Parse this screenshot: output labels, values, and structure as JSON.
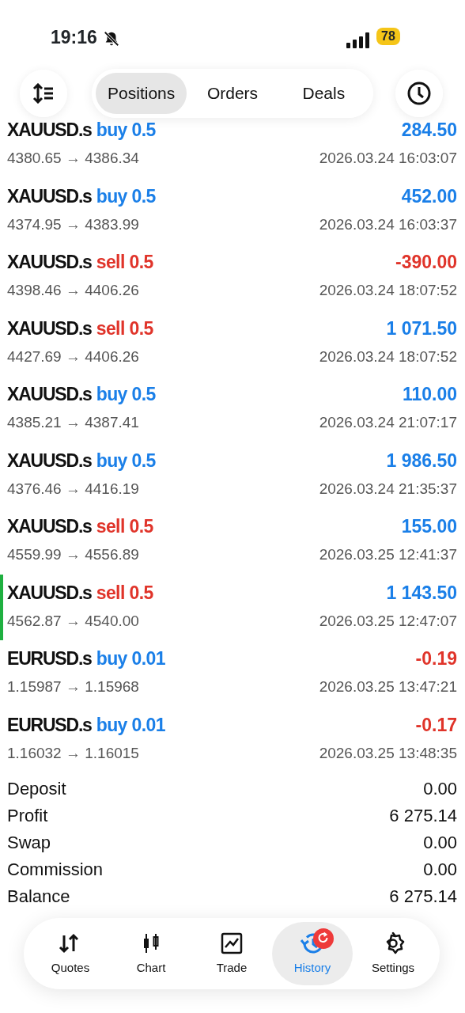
{
  "status_bar": {
    "time": "19:16",
    "battery": "78"
  },
  "toolbar": {
    "tabs": [
      {
        "label": "Positions",
        "selected": true
      },
      {
        "label": "Orders",
        "selected": false
      },
      {
        "label": "Deals",
        "selected": false
      }
    ]
  },
  "deals": [
    {
      "selected": false,
      "kind": "buy",
      "symbol": "XAUUSD.s",
      "side": "buy",
      "volume": "0.5",
      "profit": "284.50",
      "loss": false,
      "prices": "4380.65 → 4386.34",
      "time": "2026.03.24 16:03:07"
    },
    {
      "selected": false,
      "kind": "buy",
      "symbol": "XAUUSD.s",
      "side": "buy",
      "volume": "0.5",
      "profit": "452.00",
      "loss": false,
      "prices": "4374.95 → 4383.99",
      "time": "2026.03.24 16:03:37"
    },
    {
      "selected": false,
      "kind": "sell",
      "symbol": "XAUUSD.s",
      "side": "sell",
      "volume": "0.5",
      "profit": "-390.00",
      "loss": true,
      "prices": "4398.46 → 4406.26",
      "time": "2026.03.24 18:07:52"
    },
    {
      "selected": false,
      "kind": "sell",
      "symbol": "XAUUSD.s",
      "side": "sell",
      "volume": "0.5",
      "profit": "1 071.50",
      "loss": false,
      "prices": "4427.69 → 4406.26",
      "time": "2026.03.24 18:07:52"
    },
    {
      "selected": false,
      "kind": "buy",
      "symbol": "XAUUSD.s",
      "side": "buy",
      "volume": "0.5",
      "profit": "110.00",
      "loss": false,
      "prices": "4385.21 → 4387.41",
      "time": "2026.03.24 21:07:17"
    },
    {
      "selected": false,
      "kind": "buy",
      "symbol": "XAUUSD.s",
      "side": "buy",
      "volume": "0.5",
      "profit": "1 986.50",
      "loss": false,
      "prices": "4376.46 → 4416.19",
      "time": "2026.03.24 21:35:37"
    },
    {
      "selected": false,
      "kind": "sell",
      "symbol": "XAUUSD.s",
      "side": "sell",
      "volume": "0.5",
      "profit": "155.00",
      "loss": false,
      "prices": "4559.99 → 4556.89",
      "time": "2026.03.25 12:41:37"
    },
    {
      "selected": true,
      "kind": "sell",
      "symbol": "XAUUSD.s",
      "side": "sell",
      "volume": "0.5",
      "profit": "1 143.50",
      "loss": false,
      "prices": "4562.87 → 4540.00",
      "time": "2026.03.25 12:47:07"
    },
    {
      "selected": false,
      "kind": "buy",
      "symbol": "EURUSD.s",
      "side": "buy",
      "volume": "0.01",
      "profit": "-0.19",
      "loss": true,
      "prices": "1.15987 → 1.15968",
      "time": "2026.03.25 13:47:21"
    },
    {
      "selected": false,
      "kind": "buy",
      "symbol": "EURUSD.s",
      "side": "buy",
      "volume": "0.01",
      "profit": "-0.17",
      "loss": true,
      "prices": "1.16032 → 1.16015",
      "time": "2026.03.25 13:48:35"
    }
  ],
  "summary": [
    {
      "label": "Deposit",
      "value": "0.00"
    },
    {
      "label": "Profit",
      "value": "6 275.14"
    },
    {
      "label": "Swap",
      "value": "0.00"
    },
    {
      "label": "Commission",
      "value": "0.00"
    },
    {
      "label": "Balance",
      "value": "6 275.14"
    }
  ],
  "tab_bar": [
    {
      "kind": "quotes",
      "label": "Quotes",
      "selected": false,
      "badge": false
    },
    {
      "kind": "chart",
      "label": "Chart",
      "selected": false,
      "badge": false
    },
    {
      "kind": "trade",
      "label": "Trade",
      "selected": false,
      "badge": false
    },
    {
      "kind": "history",
      "label": "History",
      "selected": true,
      "badge": true
    },
    {
      "kind": "settings",
      "label": "Settings",
      "selected": false,
      "badge": false
    }
  ]
}
